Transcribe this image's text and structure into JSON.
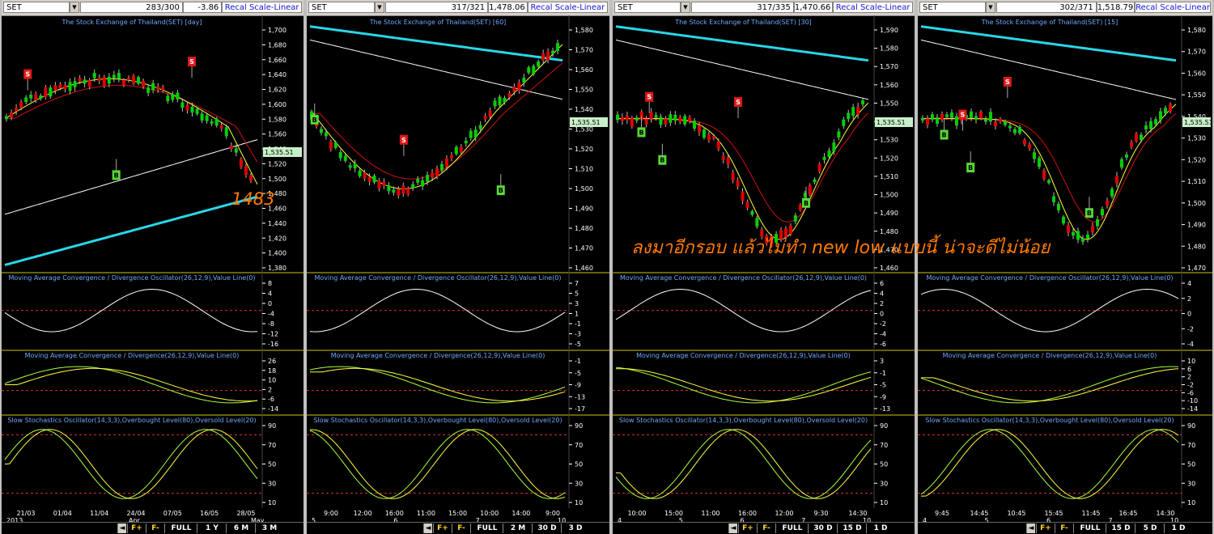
{
  "panels": [
    {
      "symbol": "SET",
      "count": "283/300",
      "value": "-3.86",
      "recal": "Recal Scale-Linear",
      "title": "The Stock Exchange of Thailand(SET) [day]",
      "price_ticks": [
        "1,700",
        "1,680",
        "1,660",
        "1,640",
        "1,620",
        "1,600",
        "1,580",
        "1,560",
        "1,540",
        "1,520",
        "1,500",
        "1,480",
        "1,460",
        "1,440",
        "1,420",
        "1,400",
        "1,380"
      ],
      "last": "1,535.51",
      "macd_title": "Moving Average Convergence / Divergence Oscillator(26,12,9),Value Line(0)",
      "macd_ticks": [
        "8",
        "4",
        "0",
        "-4",
        "-8",
        "-12",
        "-16"
      ],
      "macd2_title": "Moving Average Convergence / Divergence(26,12,9),Value Line(0)",
      "macd2_ticks": [
        "26",
        "18",
        "10",
        "2",
        "-6",
        "-14"
      ],
      "stoch_title": "Slow Stochastics Oscillator(14,3,3),Overbought Level(80),Oversold Level(20)",
      "stoch_ticks": [
        "90",
        "70",
        "50",
        "30",
        "10"
      ],
      "date_ticks": [
        "21/03",
        "01/04",
        "11/04",
        "24/04",
        "07/05",
        "16/05",
        "28/05"
      ],
      "date_ticks2": [
        "2013",
        "Apr",
        "May"
      ],
      "buttons": [
        "FULL",
        "1 Y",
        "6 M",
        "3 M"
      ]
    },
    {
      "symbol": "SET",
      "count": "317/321",
      "value": "1,478.06",
      "recal": "Recal Scale-Linear",
      "title": "The Stock Exchange of Thailand(SET) [60]",
      "price_ticks": [
        "1,580",
        "1,570",
        "1,560",
        "1,550",
        "1,540",
        "1,530",
        "1,520",
        "1,510",
        "1,500",
        "1,490",
        "1,480",
        "1,470",
        "1,460"
      ],
      "last": "1,535.51",
      "macd_title": "Moving Average Convergence / Divergence Oscillator(26,12,9),Value Line(0)",
      "macd_ticks": [
        "7",
        "5",
        "3",
        "1",
        "-1",
        "-3",
        "-5"
      ],
      "macd2_title": "Moving Average Convergence / Divergence(26,12,9),Value Line(0)",
      "macd2_ticks": [
        "-1",
        "-5",
        "-9",
        "-13",
        "-17"
      ],
      "stoch_title": "Slow Stochastics Oscillator(14,3,3),Overbought Level(80),Oversold Level(20)",
      "stoch_ticks": [
        "90",
        "70",
        "50",
        "30",
        "10"
      ],
      "date_ticks": [
        "9:00",
        "12:00",
        "16:00",
        "11:00",
        "15:00",
        "10:00",
        "14:00",
        "9:00"
      ],
      "date_ticks2": [
        "5",
        "6",
        "7",
        "10"
      ],
      "buttons": [
        "FULL",
        "2 M",
        "30 D",
        "3 D"
      ]
    },
    {
      "symbol": "SET",
      "count": "317/335",
      "value": "1,470.66",
      "recal": "Recal Scale-Linear",
      "title": "The Stock Exchange of Thailand(SET) [30]",
      "price_ticks": [
        "1,590",
        "1,580",
        "1,570",
        "1,560",
        "1,550",
        "1,540",
        "1,530",
        "1,520",
        "1,510",
        "1,500",
        "1,490",
        "1,480",
        "1,470",
        "1,460"
      ],
      "last": "1,535.51",
      "macd_title": "Moving Average Convergence / Divergence Oscillator(26,12,9),Value Line(0)",
      "macd_ticks": [
        "6",
        "4",
        "2",
        "0",
        "-2",
        "-4",
        "-6"
      ],
      "macd2_title": "Moving Average Convergence / Divergence(26,12,9),Value Line(0)",
      "macd2_ticks": [
        "3",
        "-1",
        "-5",
        "-9",
        "-13"
      ],
      "stoch_title": "Slow Stochastics Oscillator(14,3,3),Overbought Level(80),Oversold Level(20)",
      "stoch_ticks": [
        "90",
        "70",
        "50",
        "30",
        "10"
      ],
      "date_ticks": [
        "10:00",
        "15:00",
        "11:00",
        "16:00",
        "12:00",
        "9:30",
        "14:30"
      ],
      "date_ticks2": [
        "4",
        "5",
        "6",
        "7",
        "10"
      ],
      "buttons": [
        "FULL",
        "30 D",
        "15 D",
        "1 D"
      ]
    },
    {
      "symbol": "SET",
      "count": "302/371",
      "value": "1,518.79",
      "recal": "Recal Scale-Linear",
      "title": "The Stock Exchange of Thailand(SET) [15]",
      "price_ticks": [
        "1,580",
        "1,570",
        "1,560",
        "1,550",
        "1,540",
        "1,530",
        "1,520",
        "1,510",
        "1,500",
        "1,490",
        "1,480",
        "1,470"
      ],
      "last": "1,535.51",
      "macd_title": "Moving Average Convergence / Divergence Oscillator(26,12,9),Value Line(0)",
      "macd_ticks": [
        "4",
        "2",
        "0",
        "-2",
        "-4"
      ],
      "macd2_title": "Moving Average Convergence / Divergence(26,12,9),Value Line(0)",
      "macd2_ticks": [
        "10",
        "6",
        "2",
        "-2",
        "-6",
        "-10",
        "-14"
      ],
      "stoch_title": "Slow Stochastics Oscillator(14,3,3),Overbought Level(80),Oversold Level(20)",
      "stoch_ticks": [
        "90",
        "70",
        "50",
        "30",
        "10"
      ],
      "date_ticks": [
        "9:45",
        "14:45",
        "10:45",
        "15:45",
        "11:45",
        "16:45",
        "14:30"
      ],
      "date_ticks2": [
        "4",
        "5",
        "6",
        "7",
        "10"
      ],
      "buttons": [
        "FULL",
        "15 D",
        "5 D",
        "1 D"
      ]
    }
  ],
  "annotations": {
    "price_note": "1483",
    "comment": "ลงมาอีกรอบ แล้วไม่ทำ new low แบบนี้ น่าจะดีไม่น้อย"
  },
  "signals": {
    "sell": "S",
    "buy": "B"
  },
  "nav": {
    "first": "F+",
    "second": "F-"
  },
  "colors": {
    "bg": "#000000",
    "up": "#00d000",
    "down": "#e00000",
    "ma_fast": "#ffff40",
    "ma_mid": "#d01010",
    "ma_slow": "#ffffff",
    "ma_long": "#29d6e8",
    "title": "#6fa8ff",
    "annotation": "#ff7a00"
  }
}
